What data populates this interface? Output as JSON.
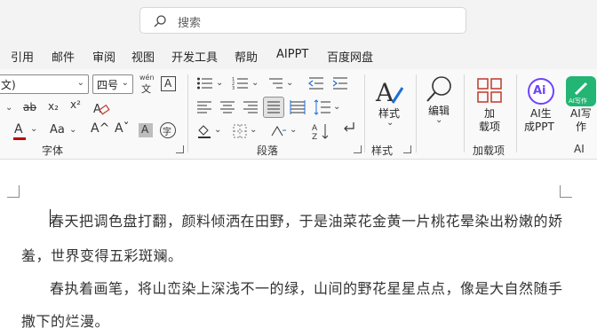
{
  "search": {
    "placeholder": "搜索",
    "icon": "search-icon"
  },
  "tabs": [
    "引用",
    "邮件",
    "审阅",
    "视图",
    "开发工具",
    "帮助",
    "AIPPT",
    "百度网盘"
  ],
  "font": {
    "name_value": "文)",
    "size_value": "四号",
    "wen_top": "wén",
    "wen_bottom": "文",
    "boxed_a": "A",
    "strike": "ab",
    "subscript": "x₂",
    "superscript": "x²",
    "font_color_a": "A",
    "aa": "Aa",
    "grow": "A^",
    "shrink": "Aˇ",
    "shade_a": "A",
    "circle_char": "字",
    "group_label": "字体"
  },
  "paragraph": {
    "group_label": "段落"
  },
  "styles": {
    "button_label": "样式",
    "group_label": "样式"
  },
  "editing": {
    "button_label": "编辑"
  },
  "addins": {
    "button_label_line1": "加",
    "button_label_line2": "载项",
    "group_label": "加载项"
  },
  "ai": {
    "ppt_line1": "AI生",
    "ppt_line2": "成PPT",
    "write_line1": "AI写",
    "write_line2": "作",
    "logo_text": "Ai",
    "write_badge": "AI写作",
    "group_label": "AI"
  },
  "colors": {
    "font_color": "#c00000",
    "ai_ppt_ring": "#6f42ff",
    "ai_write": "#22b573",
    "addins": "#c0392b"
  },
  "document": {
    "para1_line1": "春天把调色盘打翻，颜料倾洒在田野，于是油菜花金黄一片桃花晕染出粉嫩的娇",
    "para1_line2": "羞，世界变得五彩斑斓。",
    "para2_line1": "春执着画笔，将山峦染上深浅不一的绿，山间的野花星星点点，像是大自然随手",
    "para2_line2": "撒下的烂漫。"
  }
}
